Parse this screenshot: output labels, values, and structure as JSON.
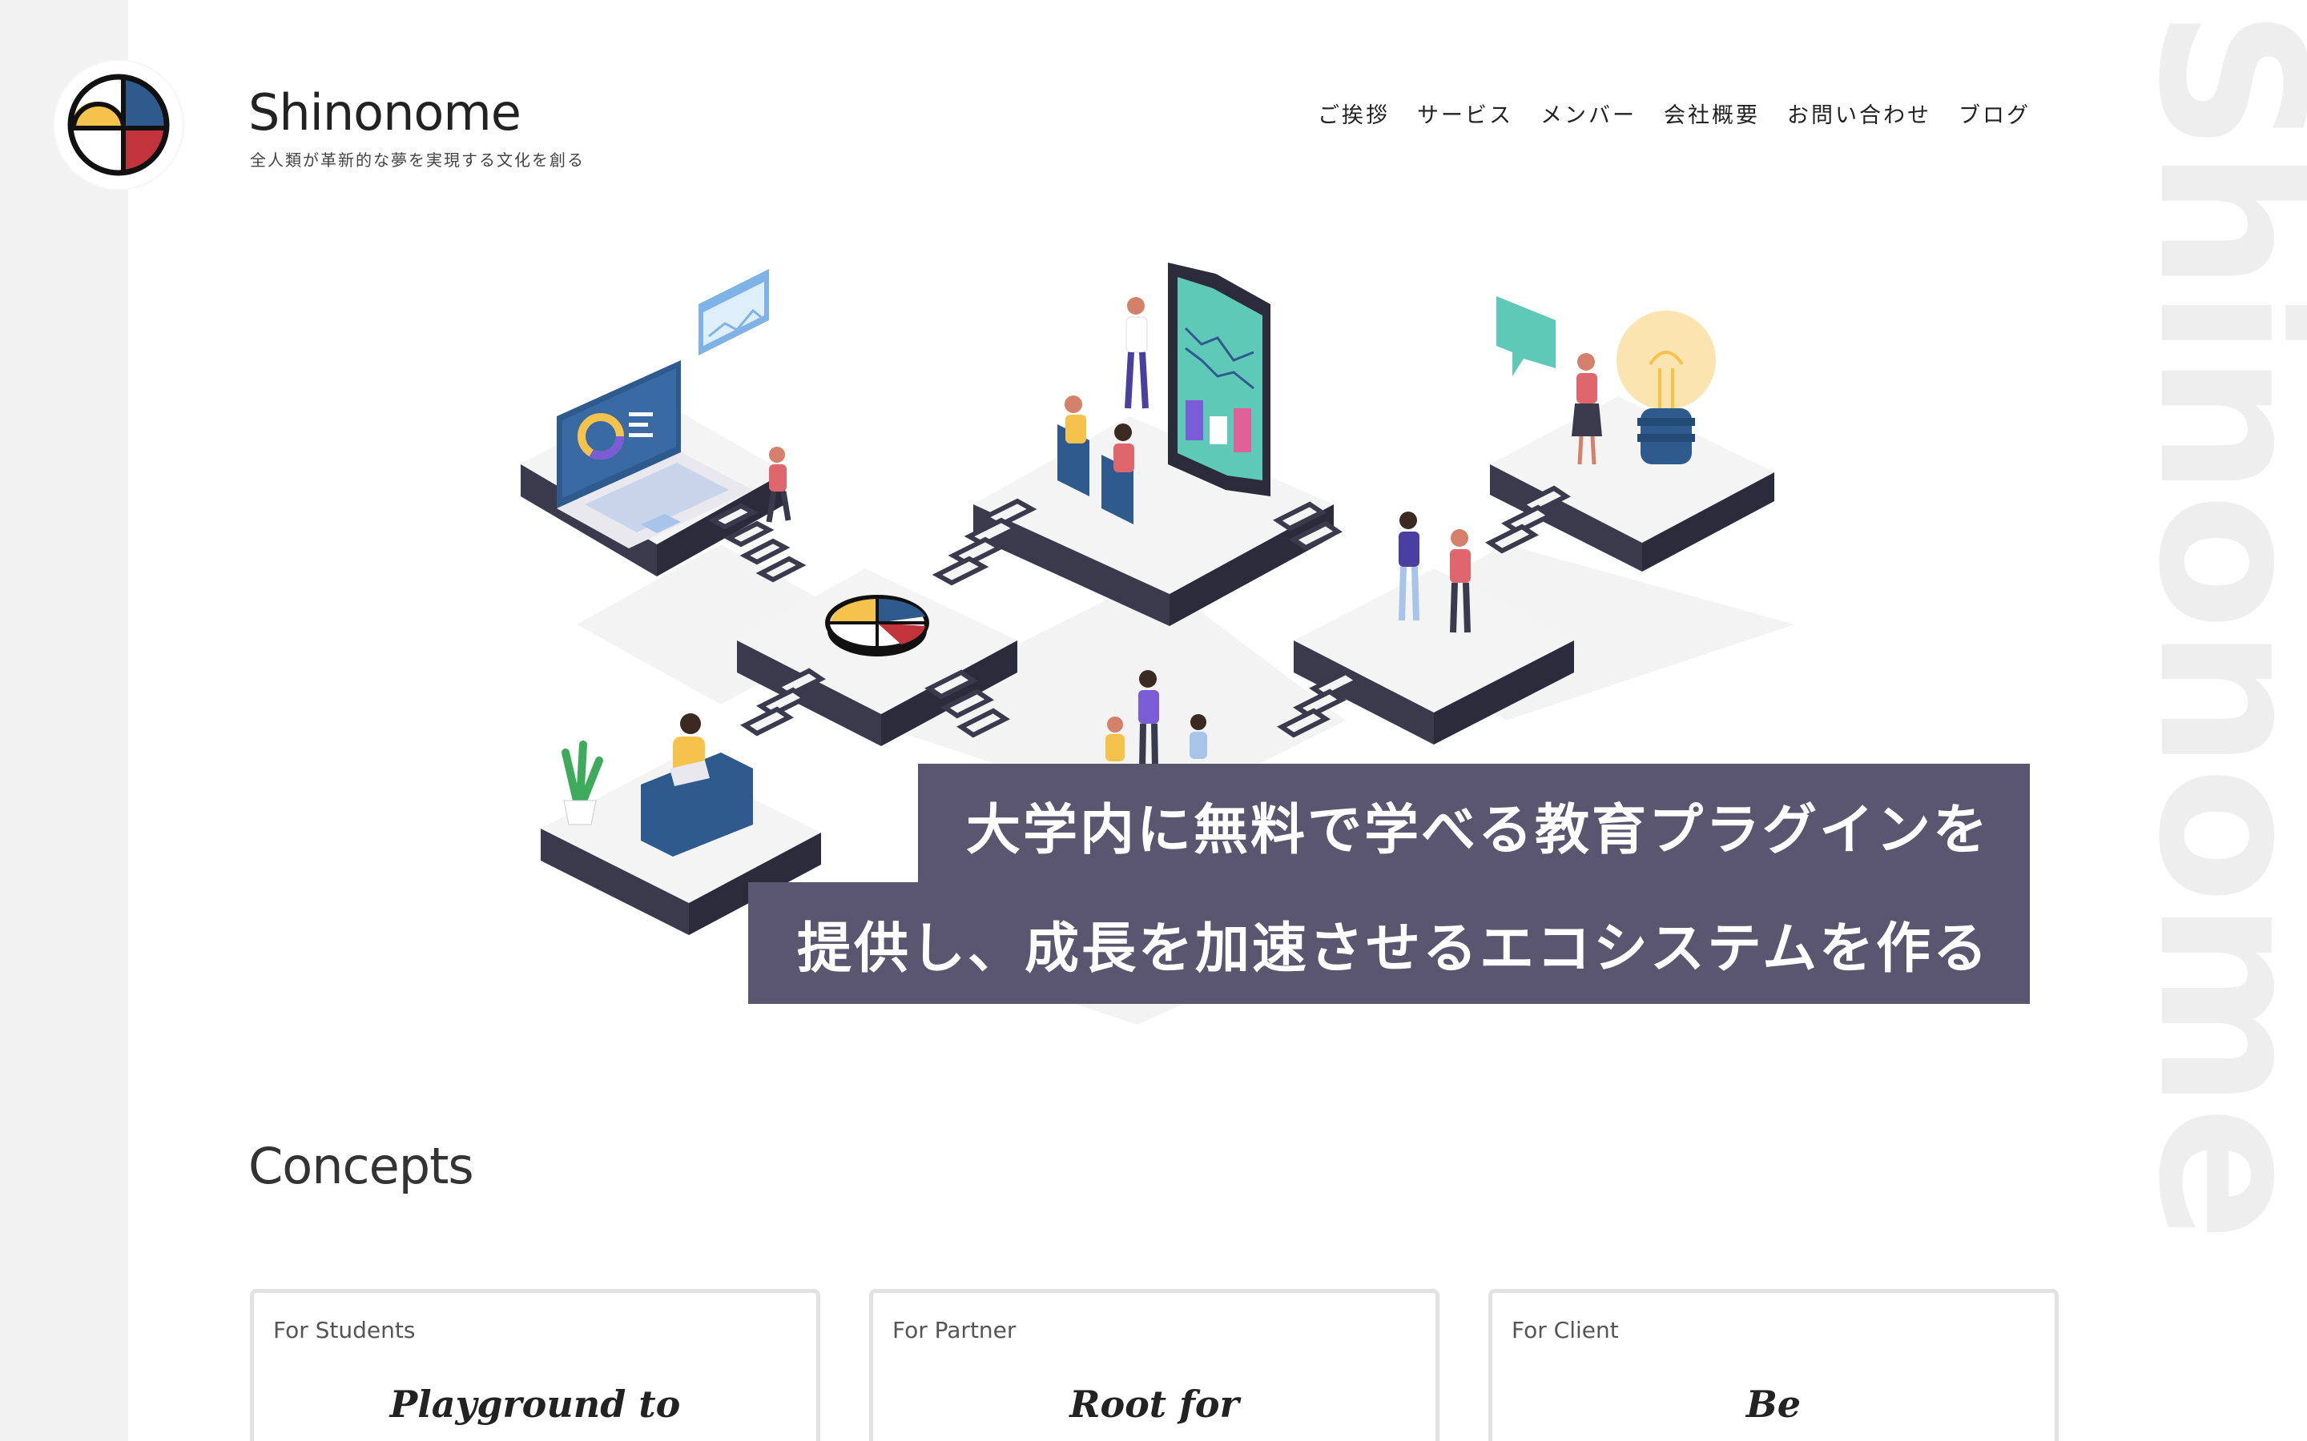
{
  "brand": {
    "name": "Shinonome",
    "tagline": "全人類が革新的な夢を実現する文化を創る",
    "logo_colors": {
      "yellow": "#f5c34b",
      "blue": "#2f5a8e",
      "red": "#c2333b",
      "outline": "#111111"
    }
  },
  "nav": {
    "items": [
      {
        "label": "ご挨拶"
      },
      {
        "label": "サービス"
      },
      {
        "label": "メンバー"
      },
      {
        "label": "会社概要"
      },
      {
        "label": "お問い合わせ"
      },
      {
        "label": "ブログ"
      }
    ]
  },
  "side_watermark": "Shinonome",
  "hero": {
    "headline_line1": "大学内に無料で学べる教育プラグインを",
    "headline_line2": "提供し、成長を加速させるエコシステムを作る",
    "illustration": "isometric-platforms-illustration"
  },
  "concepts": {
    "title": "Concepts",
    "cards": [
      {
        "label": "For Students",
        "script": "Playground to"
      },
      {
        "label": "For Partner",
        "script": "Root for"
      },
      {
        "label": "For Client",
        "script": "Be"
      }
    ]
  },
  "colors": {
    "accent_dark": "#5a5670",
    "platform_top": "#f4f4f4",
    "platform_side": "#3b3a4d",
    "rail_gray": "#f2f2f2"
  }
}
